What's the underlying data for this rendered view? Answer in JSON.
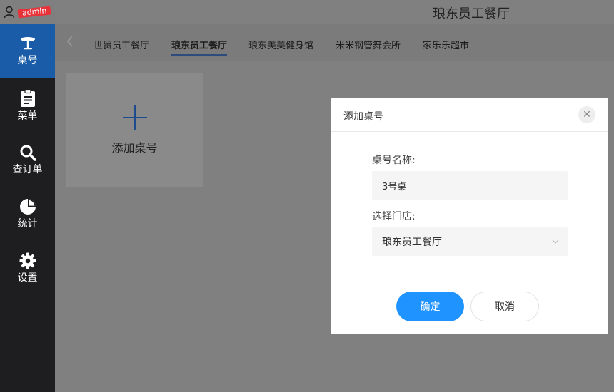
{
  "user": {
    "name": "admin",
    "icon": "user-icon"
  },
  "header": {
    "title": "琅东员工餐厅"
  },
  "sidebar": {
    "items": [
      {
        "label": "桌号",
        "icon": "table-icon",
        "active": true
      },
      {
        "label": "菜单",
        "icon": "clipboard-icon",
        "active": false
      },
      {
        "label": "查订单",
        "icon": "search-icon",
        "active": false
      },
      {
        "label": "统计",
        "icon": "pie-chart-icon",
        "active": false
      },
      {
        "label": "设置",
        "icon": "gear-icon",
        "active": false
      }
    ]
  },
  "tabs": {
    "back_icon": "chevron-left-icon",
    "items": [
      {
        "label": "世贸员工餐厅",
        "active": false
      },
      {
        "label": "琅东员工餐厅",
        "active": true
      },
      {
        "label": "琅东美美健身馆",
        "active": false
      },
      {
        "label": "米米钢管舞会所",
        "active": false
      },
      {
        "label": "家乐乐超市",
        "active": false
      }
    ]
  },
  "content": {
    "add_label": "添加桌号"
  },
  "modal": {
    "title": "添加桌号",
    "close_icon": "close-icon",
    "name_label": "桌号名称:",
    "name_value": "3号桌",
    "store_label": "选择门店:",
    "store_value": "琅东员工餐厅",
    "ok_label": "确定",
    "cancel_label": "取消"
  },
  "colors": {
    "sidebar_bg": "#1e1e20",
    "active_nav": "#1a5ca8",
    "primary_button": "#1f93ff",
    "tab_underline": "#2d4b7c"
  }
}
